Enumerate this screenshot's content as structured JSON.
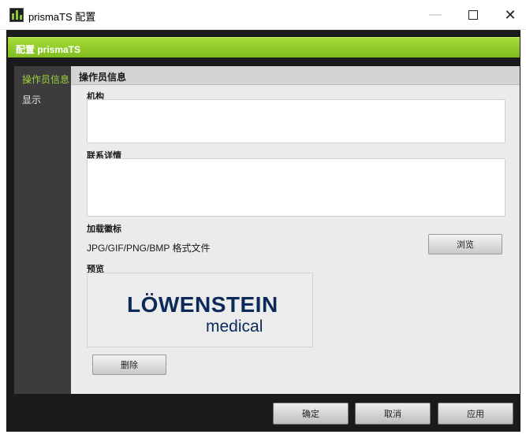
{
  "window": {
    "title": "prismaTS 配置",
    "minimize": "—",
    "close": "✕"
  },
  "header": {
    "title": "配置 prismaTS"
  },
  "sidebar": {
    "items": [
      {
        "label": "操作员信息"
      },
      {
        "label": "显示"
      }
    ]
  },
  "section": {
    "title": "操作员信息"
  },
  "form": {
    "institution_label": "机构",
    "institution_value": "",
    "contact_label": "联系详情",
    "contact_value": "",
    "logo_label": "加载徽标",
    "logo_format": "JPG/GIF/PNG/BMP 格式文件",
    "browse_label": "浏览",
    "preview_label": "预览",
    "delete_label": "删除"
  },
  "logo": {
    "name": "LÖWENSTEIN",
    "sub": "medical"
  },
  "footer": {
    "ok_label": "确定",
    "cancel_label": "取消",
    "apply_label": "应用"
  },
  "colors": {
    "accent": "#8dc63f",
    "dark_bg": "#1b1b1b",
    "sidebar_bg": "#3c3c3c",
    "content_bg": "#ebebeb"
  }
}
